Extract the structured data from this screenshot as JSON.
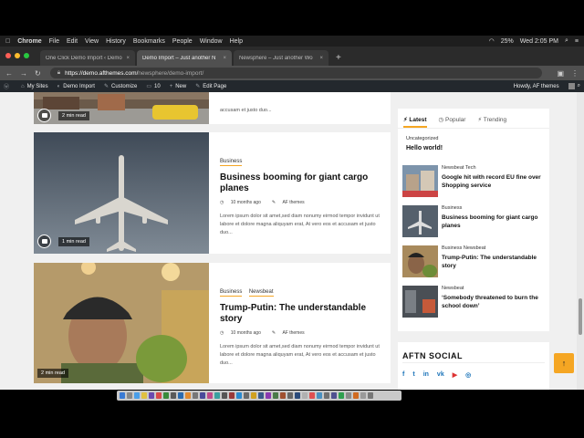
{
  "menubar": {
    "apple": "",
    "items": [
      "Chrome",
      "File",
      "Edit",
      "View",
      "History",
      "Bookmarks",
      "People",
      "Window",
      "Help"
    ],
    "battery": "25%",
    "clock": "Wed 2:05 PM"
  },
  "tabs": [
    {
      "title": "One Click Demo Import ‹ Demo",
      "close": "×"
    },
    {
      "title": "Demo Import – Just another N",
      "close": "×"
    },
    {
      "title": "Newsphere – Just another Wo",
      "close": "×"
    }
  ],
  "addressbar": {
    "host": "https://demo.afthemes.com/",
    "path": "newsphere/demo-import/"
  },
  "wpbar": {
    "my_sites": "My Sites",
    "site": "Demo Import",
    "customize": "Customize",
    "comments": "10",
    "new": "New",
    "edit": "Edit Page",
    "howdy": "Howdy, AF themes"
  },
  "posts": [
    {
      "excerpt": "accusam et justo duo...",
      "read_time": "2 min read"
    },
    {
      "categories": [
        "Business"
      ],
      "title": "Business booming for giant cargo planes",
      "date": "10 months ago",
      "author": "AF themes",
      "excerpt": "Lorem ipsum dolor sit amet,sed diam nonumy eirmod tempor invidunt ut labore et dolore magna aliquyam erat, At vero eos et accusam et justo duo...",
      "read_time": "1 min read"
    },
    {
      "categories": [
        "Business",
        "Newsbeat"
      ],
      "title": "Trump-Putin: The understandable story",
      "date": "10 months ago",
      "author": "AF themes",
      "excerpt": "Lorem ipsum dolor sit amet,sed diam nonumy eirmod tempor invidunt ut labore et dolore magna aliquyam erat, At vero eos et accusam et justo duo...",
      "read_time": "2 min read"
    }
  ],
  "sidebar": {
    "tabs": [
      "Latest",
      "Popular",
      "Trending"
    ],
    "top_category": "Uncategorized",
    "top_title": "Hello world!",
    "items": [
      {
        "cats": "Newsbeat  Tech",
        "title": "Google hit with record EU fine over Shopping service"
      },
      {
        "cats": "Business",
        "title": "Business booming for giant cargo planes"
      },
      {
        "cats": "Business  Newsbeat",
        "title": "Trump-Putin: The understandable story"
      },
      {
        "cats": "Newsbeat",
        "title": "‘Somebody threatened to burn the school down’"
      }
    ],
    "social_title": "AFTN SOCIAL",
    "social_icons": [
      "f",
      "t",
      "in",
      "vk",
      "▶",
      "◎"
    ]
  },
  "back_to_top": "↑"
}
